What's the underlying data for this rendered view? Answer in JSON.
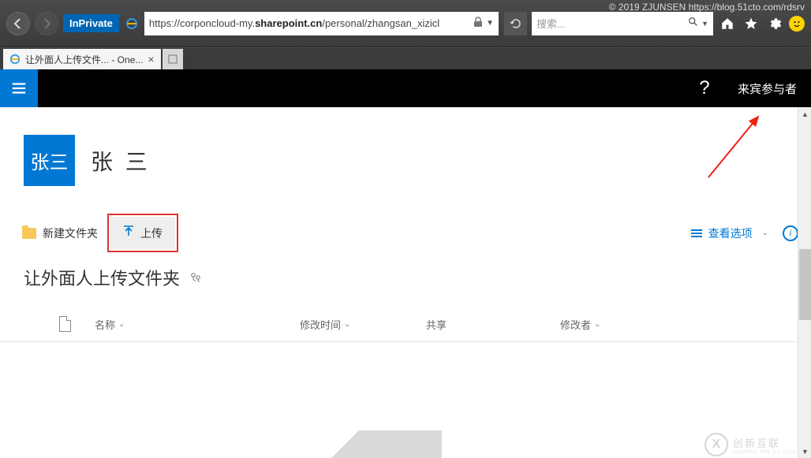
{
  "watermark": "© 2019 ZJUNSEN https://blog.51cto.com/rdsrv",
  "browser": {
    "inprivate_label": "InPrivate",
    "url_prefix": "https://corponcloud-my.",
    "url_host": "sharepoint.cn",
    "url_path": "/personal/zhangsan_xizicl",
    "search_placeholder": "搜索..."
  },
  "tab": {
    "title": "让外面人上传文件... - One..."
  },
  "suite": {
    "help": "?",
    "user": "来宾参与者"
  },
  "profile": {
    "tile": "张三",
    "name": "张 三"
  },
  "toolbar": {
    "new_folder": "新建文件夹",
    "upload": "上传",
    "view_options": "查看选项",
    "info": "i"
  },
  "folder": {
    "title": "让外面人上传文件夹"
  },
  "columns": {
    "name": "名称",
    "modified": "修改时间",
    "share": "共享",
    "modifier": "修改者"
  },
  "footer": {
    "logo": "X",
    "brand": "创新互联",
    "sub": "CHUANG XIN HU LIAN"
  }
}
